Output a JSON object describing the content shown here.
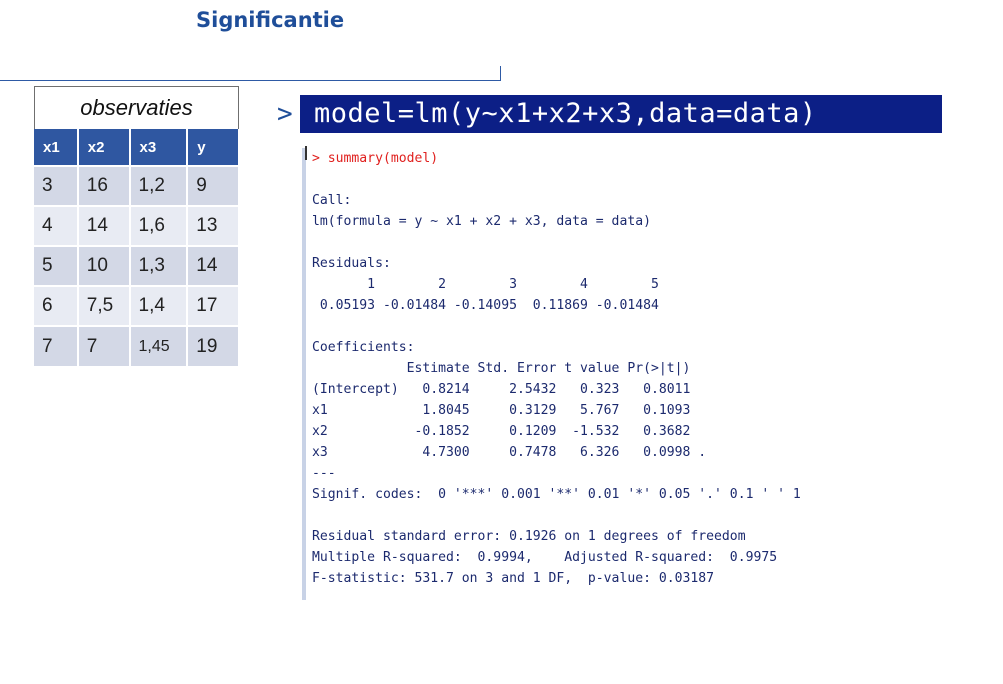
{
  "page": {
    "title": "Significantie"
  },
  "observations": {
    "caption": "observaties",
    "headers": [
      "x1",
      "x2",
      "x3",
      "y"
    ],
    "rows": [
      [
        "3",
        "16",
        "1,2",
        "9"
      ],
      [
        "4",
        "14",
        "1,6",
        "13"
      ],
      [
        "5",
        "10",
        "1,3",
        "14"
      ],
      [
        "6",
        "7,5",
        "1,4",
        "17"
      ],
      [
        "7",
        "7",
        "1,45",
        "19"
      ]
    ]
  },
  "model_command": {
    "prompt": ">",
    "text": "model=lm(y~x1+x2+x3,data=data)"
  },
  "console": {
    "command": "> summary(model)",
    "call_header": "Call:",
    "call_line": "lm(formula = y ~ x1 + x2 + x3, data = data)",
    "residuals_header": "Residuals:",
    "residuals_index": "       1        2        3        4        5",
    "residuals_values": " 0.05193 -0.01484 -0.14095  0.11869 -0.01484",
    "coef_header": "Coefficients:",
    "coef_columns": "            Estimate Std. Error t value Pr(>|t|)",
    "coef_rows": [
      "(Intercept)   0.8214     2.5432   0.323   0.8011",
      "x1            1.8045     0.3129   5.767   0.1093",
      "x2           -0.1852     0.1209  -1.532   0.3682",
      "x3            4.7300     0.7478   6.326   0.0998 ."
    ],
    "separator": "---",
    "signif_codes": "Signif. codes:  0 '***' 0.001 '**' 0.01 '*' 0.05 '.' 0.1 ' ' 1",
    "rse": "Residual standard error: 0.1926 on 1 degrees of freedom",
    "r_squared": "Multiple R-squared:  0.9994,\tAdjusted R-squared:  0.9975",
    "f_statistic": "F-statistic: 531.7 on 3 and 1 DF,  p-value: 0.03187"
  }
}
